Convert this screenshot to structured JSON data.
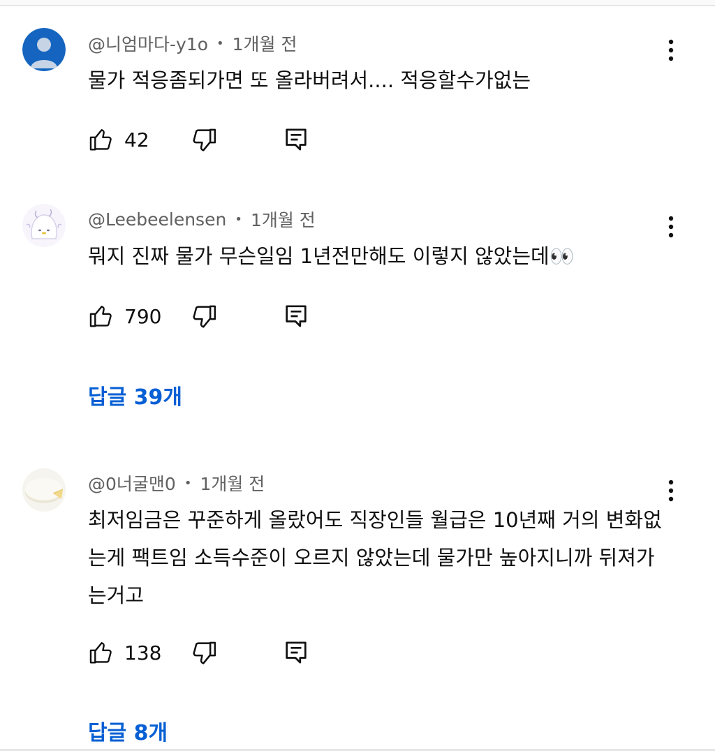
{
  "comments": [
    {
      "author": "@니엄마다-y1o",
      "time": "1개월 전",
      "text": "물가 적응좀되가면 또 올라버려서.... 적응할수가없는",
      "likes": "42",
      "avatar_icon": "default-person-icon"
    },
    {
      "author": "@Leebeelensen",
      "time": "1개월 전",
      "text": "뭐지 진짜 물가 무슨일임 1년전만해도 이렇지 않았는데👀",
      "likes": "790",
      "replies": "답글 39개",
      "avatar_icon": "ghost-character-icon"
    },
    {
      "author": "@0너굴맨0",
      "time": "1개월 전",
      "text": "최저임금은 꾸준하게 올랐어도 직장인들 월급은 10년째 거의 변화없는게 팩트임 소득수준이 오르지 않았는데 물가만 높아지니까 뒤져가는거고",
      "likes": "138",
      "replies": "답글 8개",
      "avatar_icon": "cheese-icon"
    }
  ],
  "colors": {
    "link": "#065fd4",
    "meta": "#606060",
    "text": "#0f0f0f"
  }
}
